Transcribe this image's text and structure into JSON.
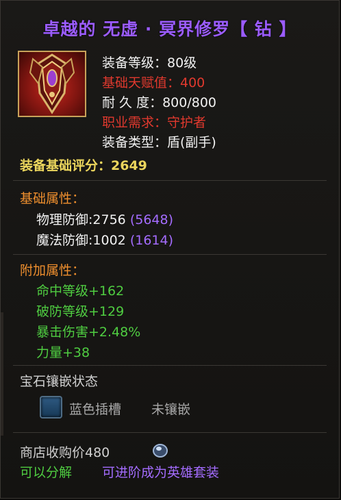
{
  "item": {
    "title": "卓越的 无虚 · 冥界修罗【 钻 】",
    "icon": "shield-offhand-icon",
    "level_text": "装备等级：80级",
    "talent_text": "基础天赋值：400",
    "durability_text": "耐 久 度：800/800",
    "class_req_text": "职业需求：守护者",
    "type_text": "装备类型：盾(副手)"
  },
  "score_text": "装备基础评分：2649",
  "base_attrs": {
    "heading": "基础属性：",
    "items": [
      {
        "label": "物理防御:2756",
        "extra": "(5648)"
      },
      {
        "label": "魔法防御:1002",
        "extra": "(1614)"
      }
    ]
  },
  "extra_attrs": {
    "heading": "附加属性：",
    "items": [
      "命中等级+162",
      "破防等级+129",
      "暴击伤害+2.48%",
      "力量+38"
    ]
  },
  "gems": {
    "heading": "宝石镶嵌状态",
    "slot_label": "蓝色插槽",
    "slot_status": "未镶嵌"
  },
  "footer": {
    "sell_price_text": "商店收购价480",
    "currency_icon": "coin-icon",
    "decompose_text": "可以分解",
    "upgrade_text": "可进阶成为英雄套装"
  },
  "colors": {
    "title": "#9b5cff",
    "red": "#e0392e",
    "yellow": "#ecd65d",
    "orange": "#ef8f2e",
    "green": "#4fcd41",
    "purple": "#a46cff"
  }
}
